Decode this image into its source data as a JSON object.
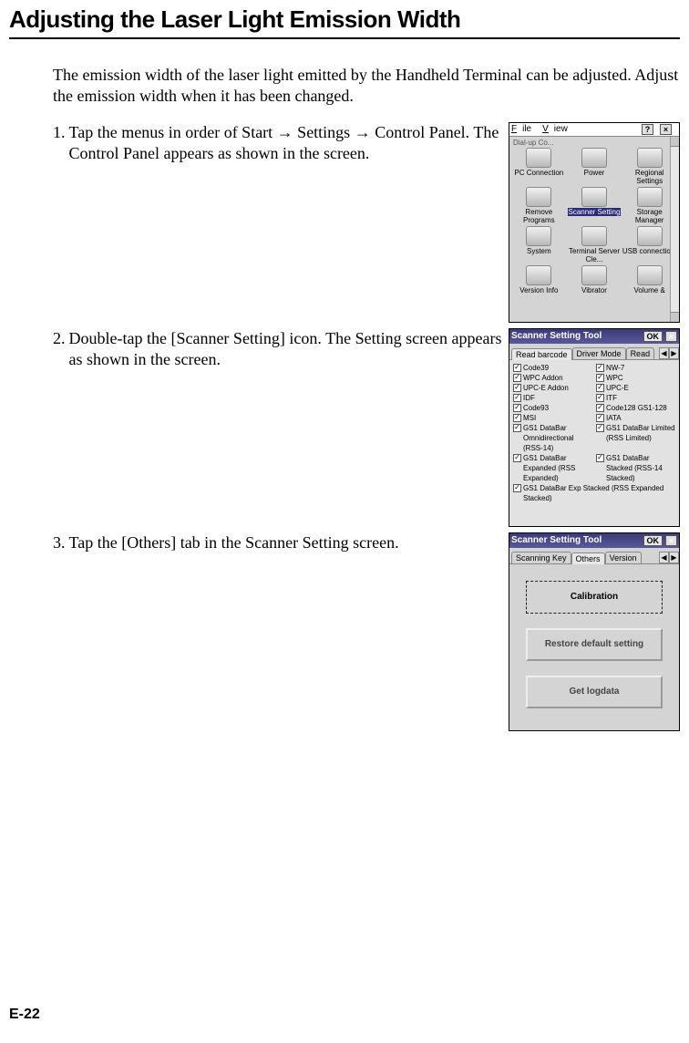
{
  "page_title": "Adjusting the Laser Light Emission Width",
  "intro": "The emission width of the laser light emitted by the Handheld Terminal can be adjusted. Adjust the emission width when it has been changed.",
  "steps": {
    "s1": {
      "num": "1.",
      "text": "Tap the menus in order of Start → Settings → Control Panel. The Control Panel appears as shown in the screen."
    },
    "s2": {
      "num": "2.",
      "text": "Double-tap the [Scanner Setting] icon. The Setting screen appears as shown in the screen."
    },
    "s3": {
      "num": "3.",
      "text": "Tap the [Others] tab in the Scanner Setting screen."
    }
  },
  "controlpanel": {
    "menu_file_char": "F",
    "menu_file_rest": "ile",
    "menu_view_char": "V",
    "menu_view_rest": "iew",
    "help": "?",
    "close": "×",
    "row_cut": "Dial-up Co...",
    "icons": [
      {
        "label": "PC Connection"
      },
      {
        "label": "Power"
      },
      {
        "label": "Regional Settings"
      },
      {
        "label": "Remove Programs"
      },
      {
        "label": "Scanner Setting",
        "selected": true
      },
      {
        "label": "Storage Manager"
      },
      {
        "label": "System"
      },
      {
        "label": "Terminal Server Cle..."
      },
      {
        "label": "USB connectio..."
      },
      {
        "label": "Version Info"
      },
      {
        "label": "Vibrator"
      },
      {
        "label": "Volume &"
      }
    ]
  },
  "scanner_tool": {
    "title": "Scanner Setting Tool",
    "ok": "OK",
    "close": "×",
    "tabs2": {
      "a": "Read barcode",
      "b": "Driver Mode",
      "c": "Read",
      "left": "◀",
      "right": "▶"
    },
    "codes_left": [
      "Code39",
      "WPC Addon",
      "UPC-E Addon",
      "IDF",
      "Code93",
      "MSI",
      "GS1 DataBar Omnidirectional (RSS-14)",
      "GS1 DataBar Expanded (RSS Expanded)"
    ],
    "codes_right": [
      "NW-7",
      "WPC",
      "UPC-E",
      "ITF",
      "Code128 GS1-128",
      "IATA",
      "GS1 DataBar Limited (RSS Limited)",
      "GS1 DataBar Stacked (RSS-14 Stacked)"
    ],
    "codes_wide": "GS1 DataBar Exp Stacked (RSS Expanded Stacked)"
  },
  "others": {
    "title": "Scanner Setting Tool",
    "ok": "OK",
    "close": "×",
    "tabs": {
      "a": "Scanning Key",
      "b": "Others",
      "c": "Version",
      "left": "◀",
      "right": "▶"
    },
    "btn1": "Calibration",
    "btn2": "Restore default setting",
    "btn3": "Get logdata"
  },
  "page_number": "E-22",
  "check": "✓"
}
